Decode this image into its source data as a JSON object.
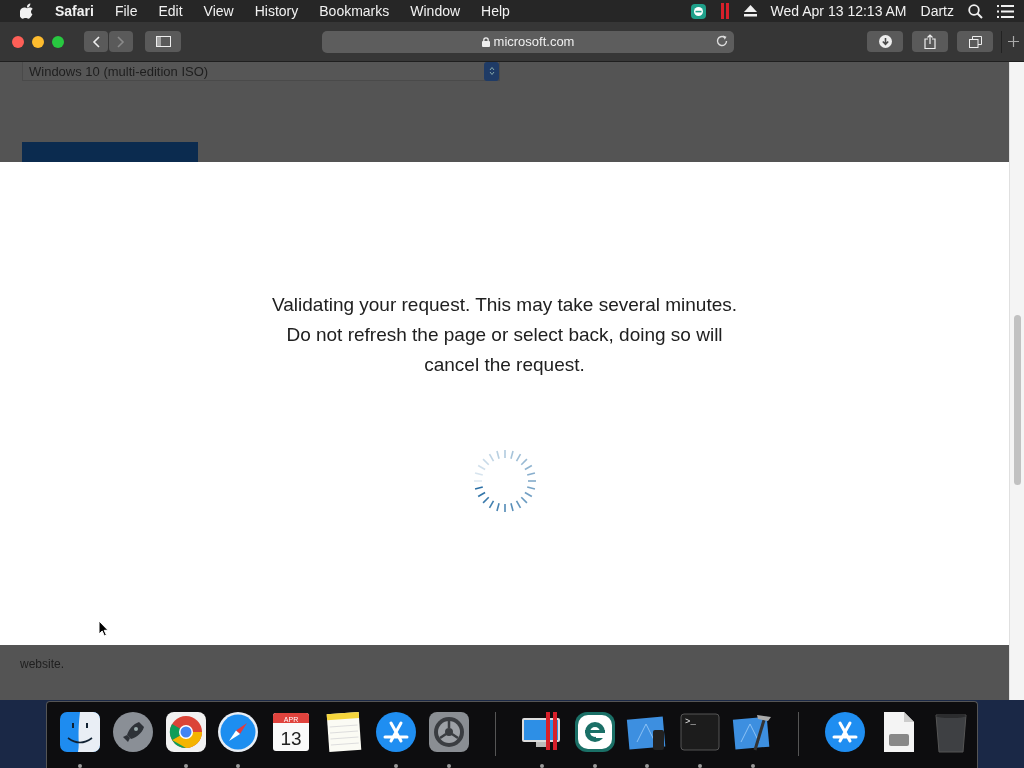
{
  "menu_bar": {
    "app_name": "Safari",
    "menus": [
      "File",
      "Edit",
      "View",
      "History",
      "Bookmarks",
      "Window",
      "Help"
    ],
    "clock": "Wed Apr 13  12:13 AM",
    "user": "Dartz"
  },
  "toolbar": {
    "address": "microsoft.com",
    "forward_disabled": true
  },
  "page": {
    "select_value": "Windows 10 (multi-edition ISO)",
    "footer_text": "website."
  },
  "modal": {
    "message": "Validating your request. This may take several minutes. Do not refresh the page or select back, doing so will cancel the request."
  },
  "dock": {
    "items": [
      {
        "kind": "finder",
        "running": true
      },
      {
        "kind": "launchpad",
        "running": false
      },
      {
        "kind": "chrome",
        "running": true
      },
      {
        "kind": "safari",
        "running": true
      },
      {
        "kind": "calendar",
        "running": false,
        "month": "APR",
        "day": "13"
      },
      {
        "kind": "notes",
        "running": false
      },
      {
        "kind": "appstore",
        "running": true
      },
      {
        "kind": "settings",
        "running": true
      },
      {
        "kind": "separator"
      },
      {
        "kind": "parallels",
        "running": true
      },
      {
        "kind": "eset",
        "running": true
      },
      {
        "kind": "simulator",
        "running": true
      },
      {
        "kind": "terminal",
        "running": true,
        "prompt": ">_"
      },
      {
        "kind": "xcode",
        "running": true
      },
      {
        "kind": "separator"
      },
      {
        "kind": "appstore",
        "running": false
      },
      {
        "kind": "document",
        "running": false
      },
      {
        "kind": "trash",
        "running": false
      }
    ]
  }
}
